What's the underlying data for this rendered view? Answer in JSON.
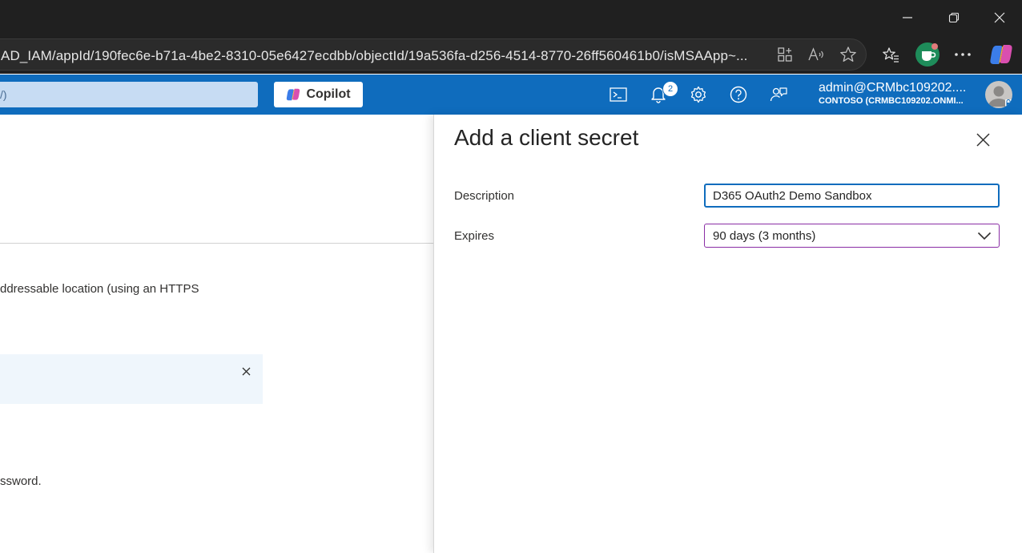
{
  "browser": {
    "url": "AD_IAM/appId/190fec6e-b71a-4be2-8310-05e6427ecdbb/objectId/19a536fa-d256-4514-8770-26ff560461b0/isMSAApp~..."
  },
  "header": {
    "search_text": "/)",
    "copilot_label": "Copilot",
    "notification_count": "2",
    "account_email": "admin@CRMbc109202....",
    "account_tenant": "CONTOSO (CRMBC109202.ONMI..."
  },
  "background": {
    "text_line1": "ddressable location (using an HTTPS",
    "text_line2": "ssword."
  },
  "panel": {
    "title": "Add a client secret",
    "description_label": "Description",
    "description_value": "D365 OAuth2 Demo Sandbox",
    "expires_label": "Expires",
    "expires_value": "90 days (3 months)"
  },
  "colors": {
    "portal_header": "#0f6cbd",
    "browser_chrome": "#202020",
    "focus_border": "#0f6cbd",
    "select_border": "#8a2da5"
  }
}
